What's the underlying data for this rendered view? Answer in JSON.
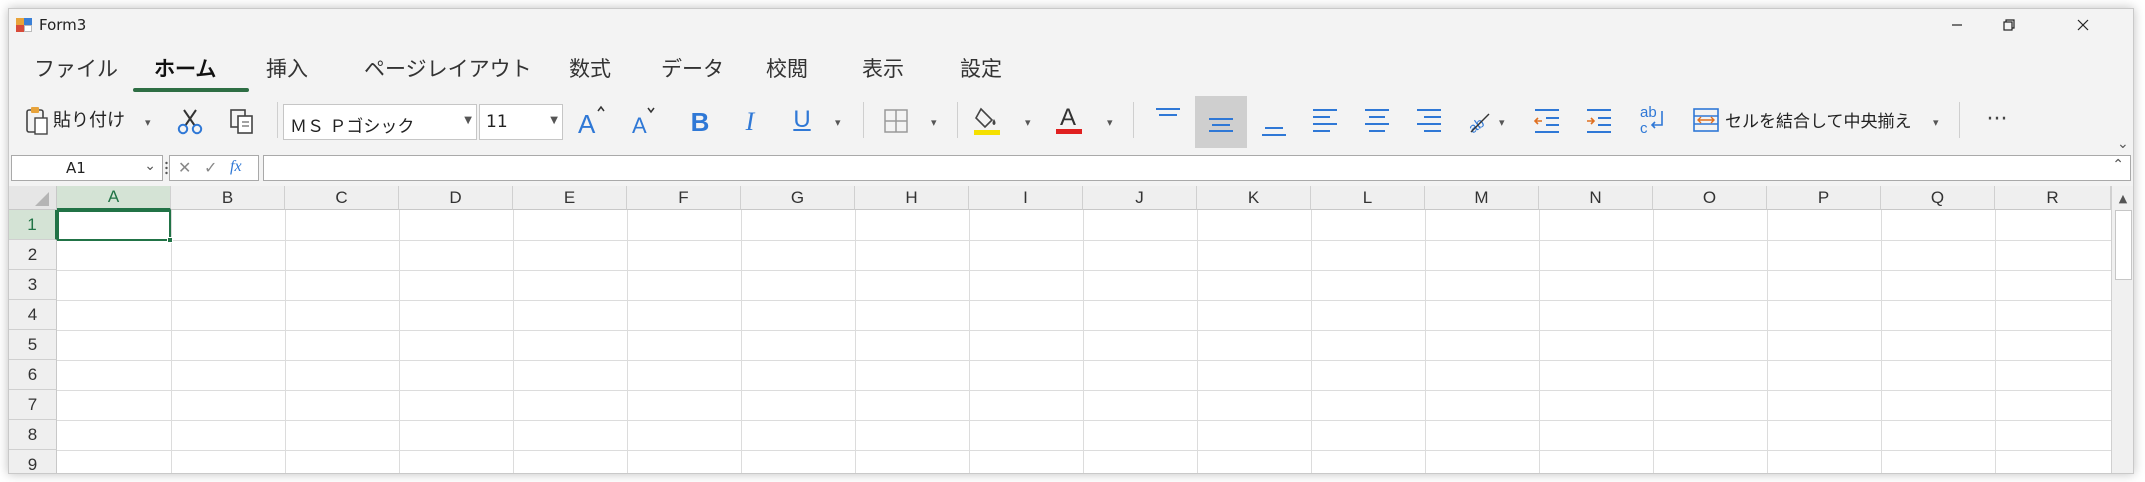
{
  "window": {
    "title": "Form3"
  },
  "title_buttons": {
    "minimize": "—",
    "restore": "⧉",
    "close": "✕"
  },
  "tabs": [
    {
      "label": "ファイル",
      "active": false
    },
    {
      "label": "ホーム",
      "active": true
    },
    {
      "label": "挿入",
      "active": false
    },
    {
      "label": "ページレイアウト",
      "active": false
    },
    {
      "label": "数式",
      "active": false
    },
    {
      "label": "データ",
      "active": false
    },
    {
      "label": "校閲",
      "active": false
    },
    {
      "label": "表示",
      "active": false
    },
    {
      "label": "設定",
      "active": false
    }
  ],
  "ribbon": {
    "paste_label": "貼り付け",
    "font_name": "ＭＳ Ｐゴシック",
    "font_size": "11",
    "bold": "B",
    "italic": "I",
    "underline": "U",
    "merge_label": "セルを結合して中央揃え",
    "more": "···",
    "font_color": "#e02020",
    "fill_color": "#f5e000",
    "accent": "#2f78d6"
  },
  "formula_bar": {
    "name_box": "A1",
    "fx": "fx",
    "value": ""
  },
  "grid": {
    "columns": [
      "A",
      "B",
      "C",
      "D",
      "E",
      "F",
      "G",
      "H",
      "I",
      "J",
      "K",
      "L",
      "M",
      "N",
      "O",
      "P",
      "Q",
      "R"
    ],
    "rows": [
      "1",
      "2",
      "3",
      "4",
      "5",
      "6",
      "7",
      "8",
      "9"
    ],
    "active_cell": "A1",
    "selection_color": "#217346"
  }
}
